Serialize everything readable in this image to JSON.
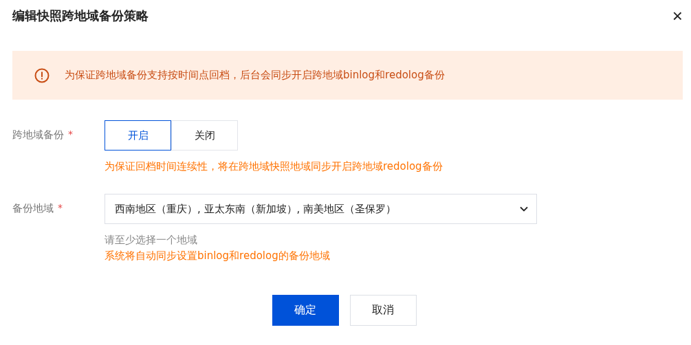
{
  "dialog": {
    "title": "编辑快照跨地域备份策略",
    "close": "×"
  },
  "alert": {
    "text": "为保证跨地域备份支持按时间点回档，后台会同步开启跨地域binlog和redolog备份"
  },
  "fields": [
    {
      "kind": "segmented",
      "label": "跨地域备份",
      "required_mark": "*",
      "options": [
        {
          "label": "开启",
          "selected": true
        },
        {
          "label": "关闭",
          "selected": false
        }
      ],
      "hints": [
        {
          "text": "为保证回档时间连续性，将在跨地域快照地域同步开启跨地域redolog备份",
          "kind": "warning"
        }
      ]
    },
    {
      "kind": "select",
      "label": "备份地域",
      "required_mark": "*",
      "value": "西南地区（重庆）, 亚太东南（新加坡）, 南美地区（圣保罗）",
      "hints": [
        {
          "text": "请至少选择一个地域",
          "kind": "muted"
        },
        {
          "text": "系统将自动同步设置binlog和redolog的备份地域",
          "kind": "warning"
        }
      ]
    }
  ],
  "buttons": [
    {
      "label": "确定",
      "kind": "primary"
    },
    {
      "label": "取消",
      "kind": "secondary"
    }
  ]
}
